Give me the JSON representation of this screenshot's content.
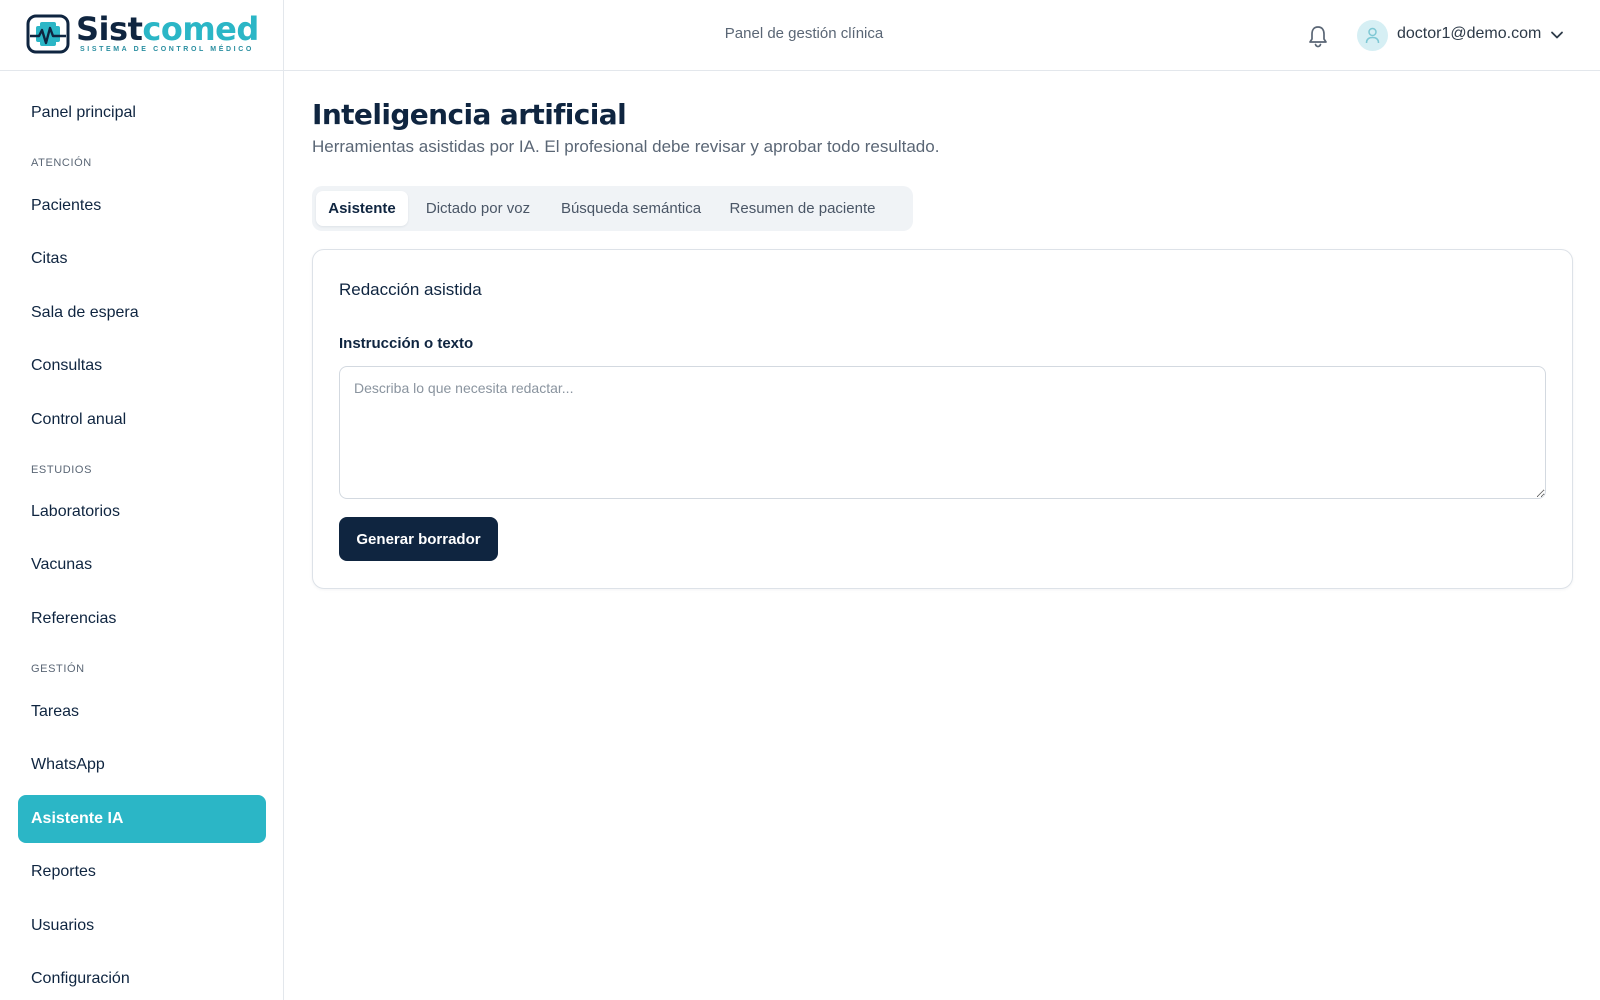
{
  "brand": {
    "name_part1": "Sist",
    "name_part2": "comed",
    "tagline": "SISTEMA DE CONTROL MÉDICO",
    "colors": {
      "navy": "#0f2540",
      "teal": "#2bb6c6"
    }
  },
  "header": {
    "title": "Panel de gestión clínica",
    "notification_icon": "bell-icon",
    "user": {
      "email": "doctor1@demo.com",
      "avatar_icon": "user-icon",
      "menu_icon": "chevron-down-icon"
    }
  },
  "sidebar": {
    "items": [
      {
        "label": "Panel principal"
      },
      {
        "section": "ATENCIÓN"
      },
      {
        "label": "Pacientes"
      },
      {
        "label": "Citas"
      },
      {
        "label": "Sala de espera"
      },
      {
        "label": "Consultas"
      },
      {
        "label": "Control anual"
      },
      {
        "section": "ESTUDIOS"
      },
      {
        "label": "Laboratorios"
      },
      {
        "label": "Vacunas"
      },
      {
        "label": "Referencias"
      },
      {
        "section": "GESTIÓN"
      },
      {
        "label": "Tareas"
      },
      {
        "label": "WhatsApp"
      },
      {
        "label": "Asistente IA",
        "active": true
      },
      {
        "label": "Reportes"
      },
      {
        "label": "Usuarios"
      },
      {
        "label": "Configuración"
      }
    ]
  },
  "main": {
    "title": "Inteligencia artificial",
    "subtitle": "Herramientas asistidas por IA. El profesional debe revisar y aprobar todo resultado.",
    "tabs": [
      {
        "label": "Asistente",
        "active": true
      },
      {
        "label": "Dictado por voz"
      },
      {
        "label": "Búsqueda semántica"
      },
      {
        "label": "Resumen de paciente"
      }
    ],
    "card": {
      "title": "Redacción asistida",
      "field_label": "Instrucción o texto",
      "textarea_value": "",
      "textarea_placeholder": "Describa lo que necesita redactar...",
      "button_label": "Generar borrador"
    }
  }
}
